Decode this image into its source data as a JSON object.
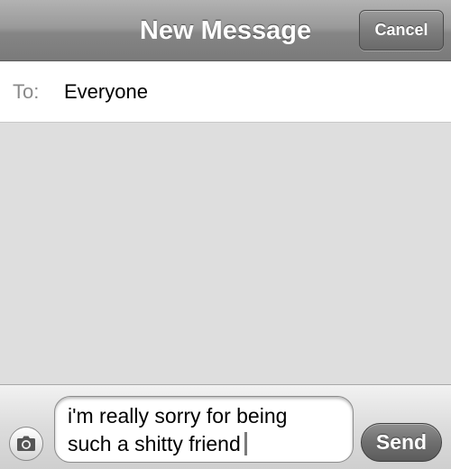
{
  "navbar": {
    "title": "New Message",
    "cancel_label": "Cancel"
  },
  "recipient": {
    "label": "To:",
    "value": "Everyone"
  },
  "compose": {
    "camera_icon": "camera-icon",
    "message_text": "i'm really sorry for being\nsuch a shitty friend",
    "send_label": "Send"
  },
  "colors": {
    "navbar": "#8e8e8e",
    "background": "#dedede",
    "send_button": "#6f6f6f"
  }
}
